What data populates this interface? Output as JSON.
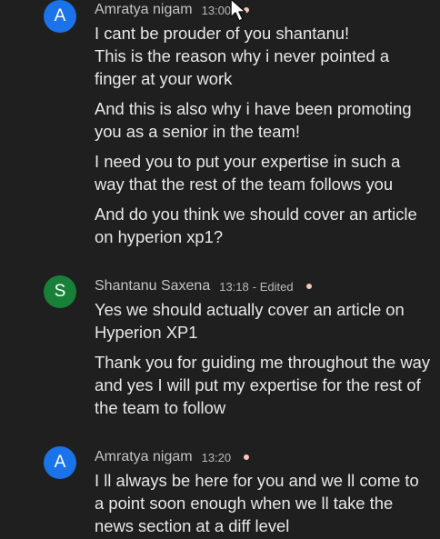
{
  "colors": {
    "avatar_a": "#1a73e8",
    "avatar_s": "#188038",
    "background": "#1f1f1f",
    "status_dot": "#f2c9b8"
  },
  "messages": [
    {
      "avatar": "A",
      "sender": "Amratya nigam",
      "time": "13:00",
      "edited": "",
      "paragraphs": [
        "I cant be prouder of you shantanu!\nThis is the reason why i never pointed a finger at your work",
        "And this is also why i have been promoting you as a senior in the team!",
        "I need you to put your expertise in such a way that the rest of the team follows you",
        "And do you think we should cover an article on hyperion xp1?"
      ]
    },
    {
      "avatar": "S",
      "sender": "Shantanu Saxena",
      "time": "13:18",
      "edited": "- Edited",
      "paragraphs": [
        "Yes we should actually cover an article on Hyperion XP1",
        "Thank you for guiding me throughout the way and yes I will put my expertise for the rest of the team to follow"
      ]
    },
    {
      "avatar": "A",
      "sender": "Amratya nigam",
      "time": "13:20",
      "edited": "",
      "paragraphs": [
        "I ll always be here for you and we ll come to a point soon enough when we ll take the news section at a diff level"
      ]
    }
  ]
}
